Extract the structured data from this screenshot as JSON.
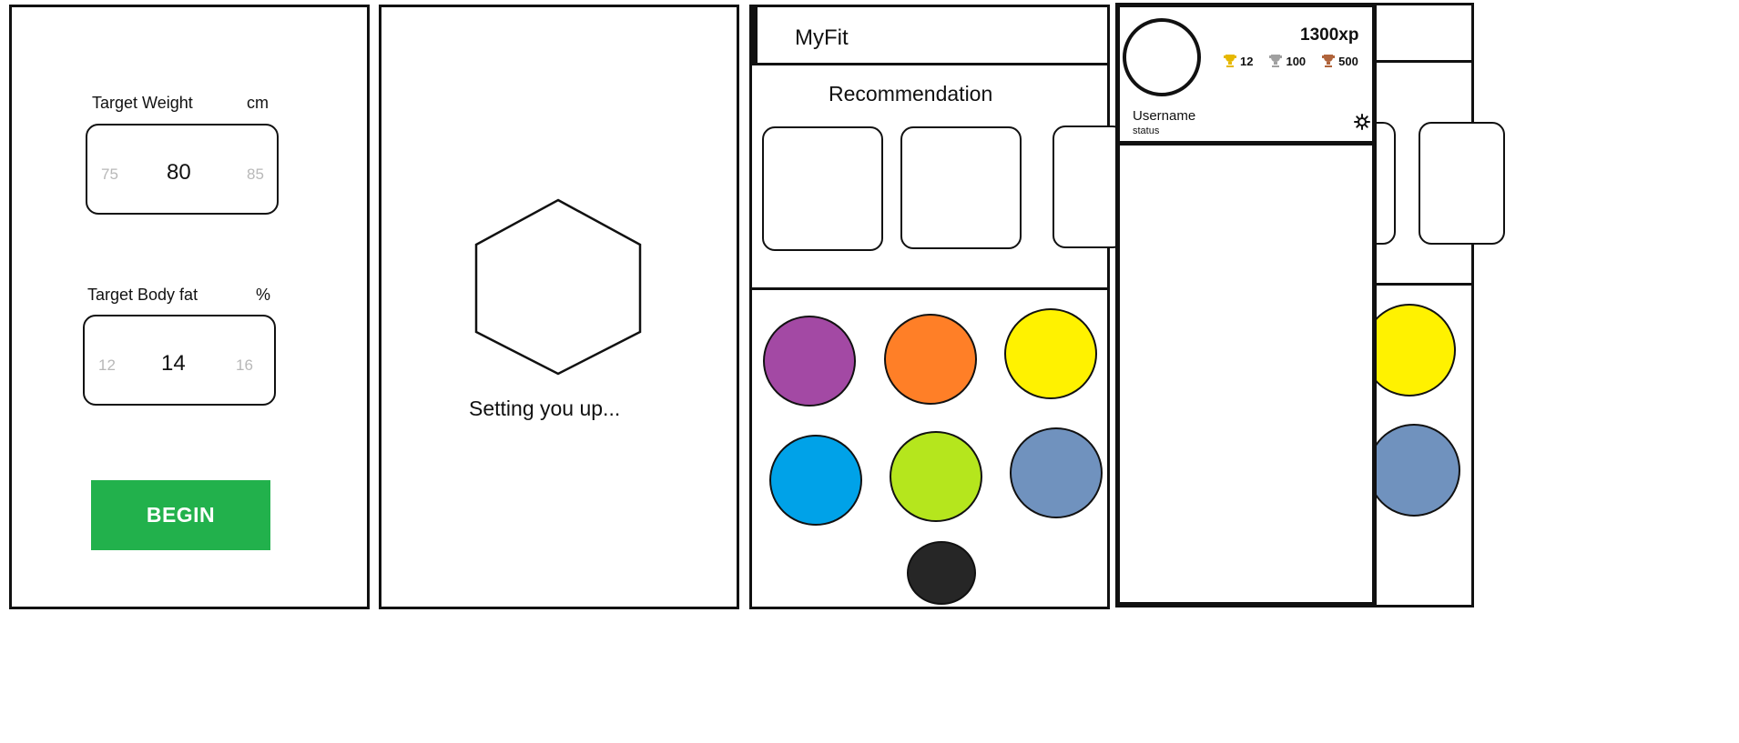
{
  "screen1": {
    "weight": {
      "label": "Target Weight",
      "unit": "cm",
      "prev": "75",
      "value": "80",
      "next": "85"
    },
    "bodyfat": {
      "label": "Target Body fat",
      "unit": "%",
      "prev": "12",
      "value": "14",
      "next": "16"
    },
    "begin_label": "BEGIN",
    "begin_color": "#22b14c"
  },
  "screen2": {
    "loading_text": "Setting you up..."
  },
  "screen3": {
    "app_title": "MyFit",
    "section_title": "Recommendation",
    "category_colors": [
      "#a349a4",
      "#ff7f27",
      "#fff200",
      "#00a2e8",
      "#b5e61d",
      "#7092be",
      "#262626"
    ]
  },
  "screen4": {
    "xp": "1300xp",
    "username": "Username",
    "status": "status",
    "trophies": [
      {
        "icon": "gold-trophy-icon",
        "color": "#e6b800",
        "count": "12"
      },
      {
        "icon": "silver-trophy-icon",
        "color": "#a0a0a0",
        "count": "100"
      },
      {
        "icon": "bronze-trophy-icon",
        "color": "#b0643c",
        "count": "500"
      }
    ],
    "settings_icon": "gear-icon"
  }
}
